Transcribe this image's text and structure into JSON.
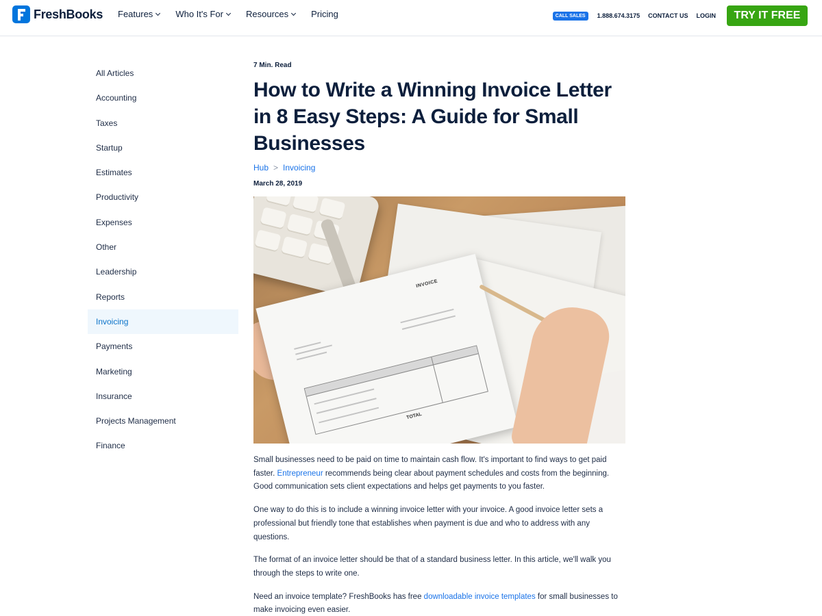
{
  "header": {
    "logo_text": "FreshBooks",
    "nav": [
      {
        "label": "Features",
        "dropdown": true
      },
      {
        "label": "Who It's For",
        "dropdown": true
      },
      {
        "label": "Resources",
        "dropdown": true
      },
      {
        "label": "Pricing",
        "dropdown": false
      }
    ],
    "call_sales": "CALL SALES",
    "phone": "1.888.674.3175",
    "contact": "CONTACT US",
    "login": "LOGIN",
    "cta": "TRY IT FREE"
  },
  "sidebar": {
    "items": [
      {
        "label": "All Articles",
        "active": false
      },
      {
        "label": "Accounting",
        "active": false
      },
      {
        "label": "Taxes",
        "active": false
      },
      {
        "label": "Startup",
        "active": false
      },
      {
        "label": "Estimates",
        "active": false
      },
      {
        "label": "Productivity",
        "active": false
      },
      {
        "label": "Expenses",
        "active": false
      },
      {
        "label": "Other",
        "active": false
      },
      {
        "label": "Leadership",
        "active": false
      },
      {
        "label": "Reports",
        "active": false
      },
      {
        "label": "Invoicing",
        "active": true
      },
      {
        "label": "Payments",
        "active": false
      },
      {
        "label": "Marketing",
        "active": false
      },
      {
        "label": "Insurance",
        "active": false
      },
      {
        "label": "Projects Management",
        "active": false
      },
      {
        "label": "Finance",
        "active": false
      }
    ]
  },
  "article": {
    "read_time": "7 Min. Read",
    "title": "How to Write a Winning Invoice Letter in 8 Easy Steps: A Guide for Small Businesses",
    "breadcrumb": {
      "hub": "Hub",
      "separator": ">",
      "category": "Invoicing"
    },
    "date": "March 28, 2019",
    "hero_labels": {
      "invoice": "INVOICE",
      "total": "TOTAL"
    },
    "p1": {
      "before": "Small businesses need to be paid on time to maintain cash flow. It's important to find ways to get paid faster. ",
      "link": "Entrepreneur",
      "after": " recommends being clear about payment schedules and costs from the beginning. Good communication sets client expectations and helps get payments to you faster."
    },
    "p2": "One way to do this is to include a winning invoice letter with your invoice. A good invoice letter sets a professional but friendly tone that establishes when payment is due and who to address with any questions.",
    "p3": "The format of an invoice letter should be that of a standard business letter. In this article, we'll walk you through the steps to write one.",
    "p4": {
      "before": "Need an invoice template? FreshBooks has free ",
      "link": "downloadable invoice templates",
      "after": " for small businesses to make invoicing even easier."
    }
  },
  "colors": {
    "brand_blue": "#0075dd",
    "link_blue": "#1a73e8",
    "cta_green": "#37a512",
    "text_dark": "#0d1f3c",
    "active_bg": "#eff7fd"
  }
}
